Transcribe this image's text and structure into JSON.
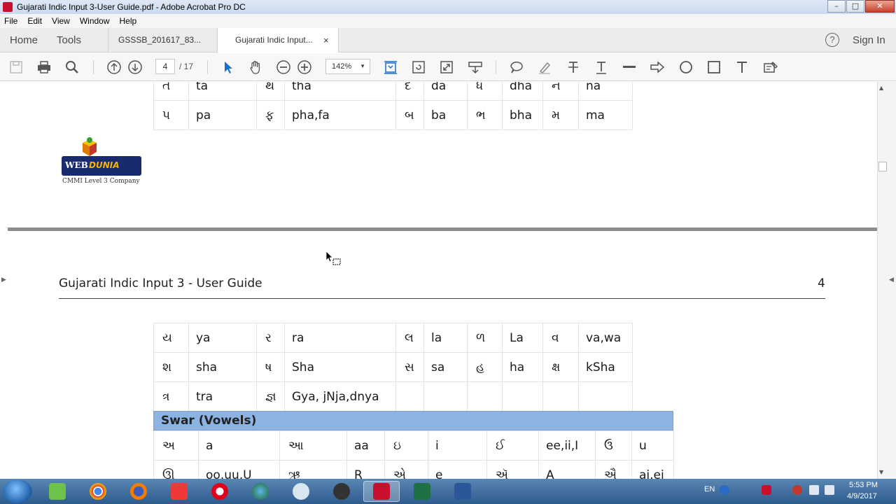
{
  "window": {
    "title": "Gujarati Indic Input 3-User Guide.pdf - Adobe Acrobat Pro DC",
    "controls": [
      "minimize",
      "maximize",
      "close"
    ]
  },
  "menu": [
    "File",
    "Edit",
    "View",
    "Window",
    "Help"
  ],
  "tabs": {
    "home": "Home",
    "tools": "Tools",
    "doc1": "GSSSB_201617_83...",
    "doc2": "Gujarati Indic Input...",
    "close_glyph": "×",
    "sign_in": "Sign In",
    "help_glyph": "?"
  },
  "toolbar": {
    "current_page": "4",
    "total_pages": "/ 17",
    "zoom": "142%",
    "icons": [
      "save-icon",
      "print-icon",
      "search-icon",
      "page-up-icon",
      "page-down-icon",
      "select-arrow-icon",
      "hand-icon",
      "zoom-out-icon",
      "zoom-in-icon",
      "fit-page-icon",
      "rotate-icon",
      "full-screen-icon",
      "scroll-icon",
      "comment-icon",
      "highlight-icon",
      "strikethrough-icon",
      "text-underline-icon",
      "line-icon",
      "arrow-icon",
      "circle-icon",
      "rectangle-icon",
      "text-box-icon",
      "add-text-icon"
    ]
  },
  "document": {
    "top_table_rows": [
      [
        "ત",
        "ta",
        "થ",
        "tha",
        "દ",
        "da",
        "ધ",
        "dha",
        "ન",
        "na"
      ],
      [
        "પ",
        "pa",
        "ફ",
        "pha,fa",
        "બ",
        "ba",
        "ભ",
        "bha",
        "મ",
        "ma"
      ]
    ],
    "logo": {
      "brand_web": "WEB",
      "brand_dunia": "DUNIA",
      "tagline": "CMMI Level 3 Company"
    },
    "page_header": "Gujarati Indic Input 3 - User Guide",
    "page_number": "4",
    "consonant_rows": [
      [
        "ય",
        "ya",
        "ર",
        "ra",
        "લ",
        "la",
        "ળ",
        "La",
        "વ",
        "va,wa"
      ],
      [
        "શ",
        "sha",
        "ષ",
        "Sha",
        "સ",
        "sa",
        "હ",
        "ha",
        "ક્ષ",
        "kSha"
      ],
      [
        "ત્ર",
        "tra",
        "જ્ઞ",
        "Gya, jNja,dnya",
        "",
        "",
        "",
        "",
        "",
        ""
      ]
    ],
    "swar_heading": "Swar (Vowels)",
    "vowel_rows": [
      [
        "અ",
        "a",
        "આ",
        "aa",
        "ઇ",
        "i",
        "ઈ",
        "ee,ii,I",
        "ઉ",
        "u"
      ],
      [
        "ઊ",
        "oo,uu,U",
        "ઋ",
        "R",
        "એ",
        "e",
        "ઍ",
        "A",
        "ઐ",
        "ai,ei"
      ]
    ]
  },
  "taskbar": {
    "apps": [
      "windows-explorer",
      "chrome",
      "firefox",
      "vivaldi",
      "opera",
      "network",
      "paint",
      "media",
      "acrobat",
      "excel",
      "word"
    ],
    "language": "EN",
    "time": "5:53 PM",
    "date": "4/9/2017"
  }
}
